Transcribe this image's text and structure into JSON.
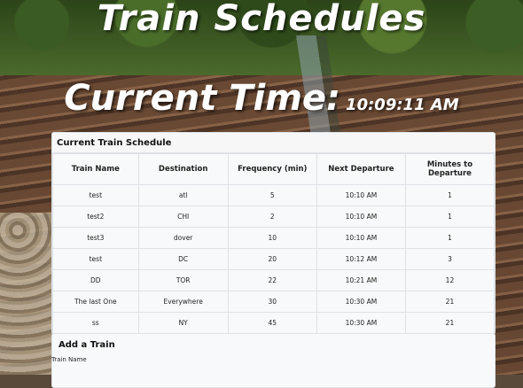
{
  "header": {
    "title": "Train Schedules",
    "time_label": "Current Time:",
    "time_value": "10:09:11 AM"
  },
  "schedule": {
    "title": "Current Train Schedule",
    "columns": [
      "Train Name",
      "Destination",
      "Frequency (min)",
      "Next Departure",
      "Minutes to Departure"
    ],
    "rows": [
      [
        "test",
        "atl",
        "5",
        "10:10 AM",
        "1"
      ],
      [
        "test2",
        "CHI",
        "2",
        "10:10 AM",
        "1"
      ],
      [
        "test3",
        "dover",
        "10",
        "10:10 AM",
        "1"
      ],
      [
        "test",
        "DC",
        "20",
        "10:12 AM",
        "3"
      ],
      [
        "DD",
        "TOR",
        "22",
        "10:21 AM",
        "12"
      ],
      [
        "The last One",
        "Everywhere",
        "30",
        "10:30 AM",
        "21"
      ],
      [
        "ss",
        "NY",
        "45",
        "10:30 AM",
        "21"
      ]
    ]
  },
  "add_train": {
    "title": "Add a Train",
    "train_name_label": "Train Name"
  }
}
